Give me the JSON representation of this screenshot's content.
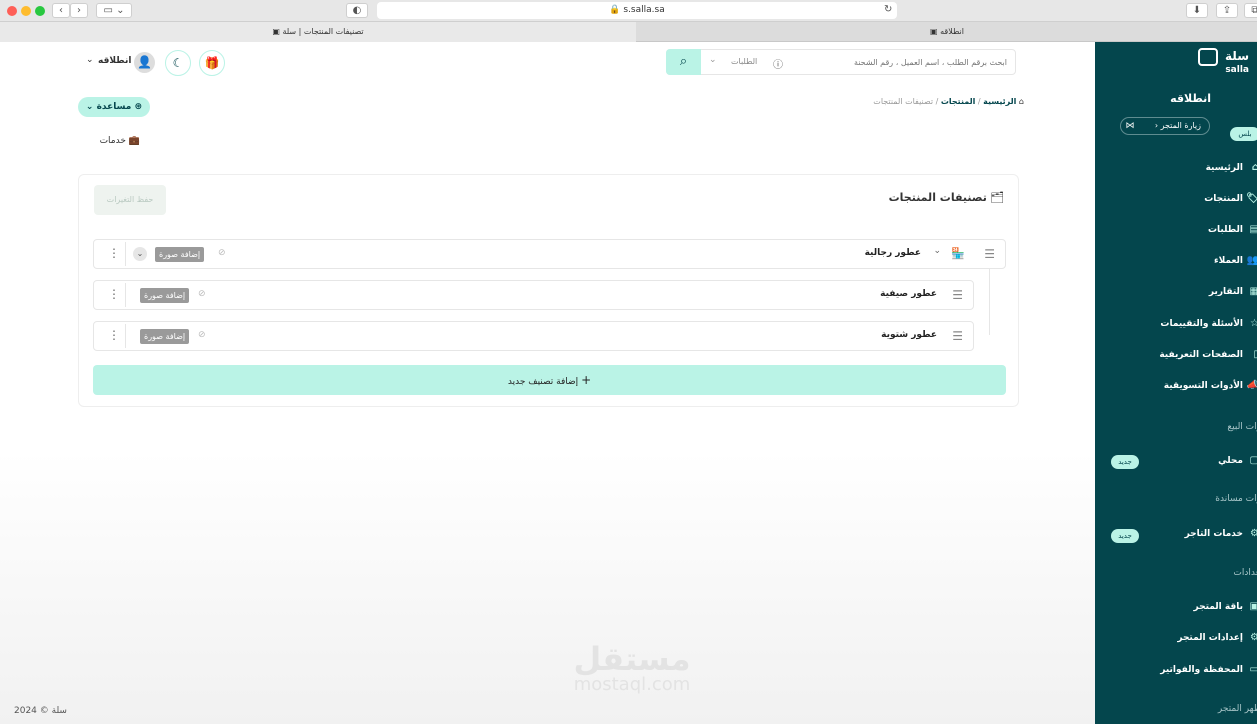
{
  "browser": {
    "url": "s.salla.sa",
    "tabs": [
      {
        "title": "تصنيفات المنتجات | سلة"
      },
      {
        "title": "انطلاقه"
      }
    ]
  },
  "header": {
    "search_placeholder": "ابحث برقم الطلب ، اسم العميل ، رقم الشحنة",
    "search_scope": "الطلبات",
    "user_name": "انطلاقه"
  },
  "breadcrumb": [
    "الرئيسية",
    "المنتجات",
    "تصنيفات المنتجات"
  ],
  "help": {
    "label": "مساعدة"
  },
  "services": {
    "label": "خدمات"
  },
  "page": {
    "title": "تصنيفات المنتجات",
    "save_label": "حفظ التغيرات",
    "add_category_label": "إضافة تصنيف جديد",
    "categories": [
      {
        "name": "عطور رجالية",
        "add_image": "إضافة صورة"
      },
      {
        "name": "عطور صيفية",
        "add_image": "إضافة صورة"
      },
      {
        "name": "عطور شتوية",
        "add_image": "إضافة صورة"
      }
    ]
  },
  "footer": {
    "copyright": "سلة © 2024"
  },
  "sidebar": {
    "brand": "سلة",
    "brand_latin": "salla",
    "store_name": "انطلاقه",
    "visit_store": "زيارة المتجر",
    "plan_badge": "بلس",
    "items": [
      {
        "label": "الرئيسية"
      },
      {
        "label": "المنتجات"
      },
      {
        "label": "الطلبات"
      },
      {
        "label": "العملاء"
      },
      {
        "label": "التقارير"
      },
      {
        "label": "الأسئلة والتقييمات"
      },
      {
        "label": "الصفحات التعريفية"
      },
      {
        "label": "الأدوات التسويقية"
      }
    ],
    "section_sales": "وات البيع",
    "local": {
      "label": "محلي",
      "badge": "جديد"
    },
    "section_support": "وات مساندة",
    "merchant": {
      "label": "خدمات التاجر",
      "badge": "جديد"
    },
    "section_settings": "عدادات",
    "settings_items": [
      {
        "label": "باقة المتجر"
      },
      {
        "label": "إعدادات المتجر"
      },
      {
        "label": "المحفظة والفواتير"
      }
    ],
    "section_look": "ظهر المتجر"
  },
  "watermark": {
    "arabic": "مستقل",
    "latin": "mostaql.com"
  },
  "colors": {
    "sidebar": "#04464d",
    "accent": "#baf3e6",
    "primary_text": "#04464d"
  }
}
